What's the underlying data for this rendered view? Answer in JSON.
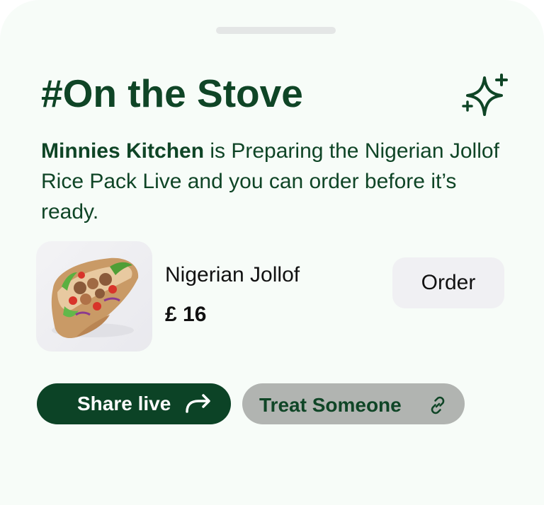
{
  "sheet": {
    "title": "#On the Stove",
    "sparkle_icon": "sparkle-icon",
    "description": {
      "vendor": "Minnies Kitchen",
      "text": " is Preparing the Nigerian Jollof Rice Pack Live and you can order before it’s ready."
    }
  },
  "item": {
    "image_icon": "food-wrap-image",
    "name": "Nigerian Jollof",
    "price": "£ 16",
    "order_label": "Order"
  },
  "actions": {
    "share_label": "Share live",
    "share_icon": "share-arrow-icon",
    "treat_label": "Treat Someone",
    "treat_icon": "link-icon"
  },
  "colors": {
    "primary": "#0c4326",
    "text_dark_green": "#0f4526",
    "sheet_bg": "#f7fcf8",
    "order_bg": "#f0f0f3",
    "treat_bg": "#b1b4b1"
  }
}
